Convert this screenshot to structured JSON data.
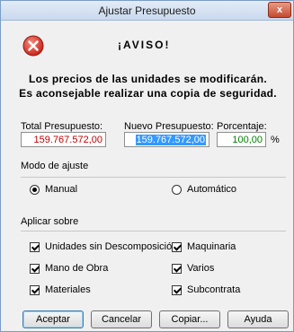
{
  "window": {
    "title": "Ajustar Presupuesto",
    "close_label": "x"
  },
  "alert": {
    "icon": "error-icon",
    "heading": "¡AVISO!",
    "line1": "Los precios de las unidades se modificarán.",
    "line2": "Es aconsejable realizar una copia de seguridad."
  },
  "fields": {
    "total_label": "Total Presupuesto:",
    "total_value": "159.767.572,00",
    "nuevo_label": "Nuevo Presupuesto:",
    "nuevo_value": "159.767.572,00",
    "porcentaje_label": "Porcentaje:",
    "porcentaje_value": "100,00",
    "percent_sign": "%"
  },
  "modo": {
    "title": "Modo de ajuste",
    "manual_label": "Manual",
    "automatico_label": "Automático",
    "selected": "manual"
  },
  "aplicar": {
    "title": "Aplicar sobre",
    "items": [
      {
        "label": "Unidades sin Descomposición",
        "checked": true
      },
      {
        "label": "Maquinaria",
        "checked": true
      },
      {
        "label": "Mano de Obra",
        "checked": true
      },
      {
        "label": "Varios",
        "checked": true
      },
      {
        "label": "Materiales",
        "checked": true
      },
      {
        "label": "Subcontrata",
        "checked": true
      }
    ]
  },
  "buttons": {
    "aceptar": "Aceptar",
    "cancelar": "Cancelar",
    "copiar": "Copiar...",
    "ayuda": "Ayuda"
  },
  "colors": {
    "total_value": "#c00000",
    "percent_value": "#008000",
    "selection": "#3399ff",
    "error_icon": "#d9261c"
  }
}
